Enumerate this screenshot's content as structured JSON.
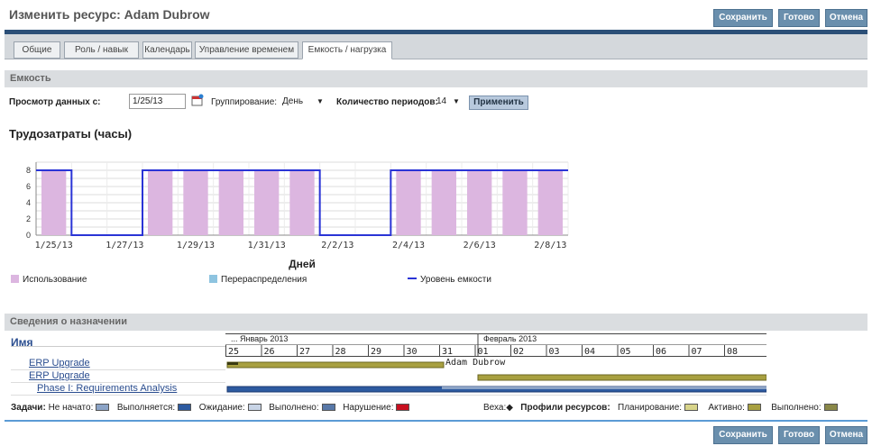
{
  "header": {
    "title": "Изменить ресурс: Adam Dubrow",
    "save": "Сохранить",
    "done": "Готово",
    "cancel": "Отмена"
  },
  "tabs": [
    "Общие",
    "Роль / навык",
    "Календарь",
    "Управление временем",
    "Емкость / нагрузка"
  ],
  "capacity": {
    "section_title": "Емкость",
    "view_from_label": "Просмотр данных с:",
    "view_from_value": "1/25/13",
    "grouping_label": "Группирование:",
    "grouping_value": "День",
    "periods_label": "Количество периодов:",
    "periods_value": "14",
    "apply": "Применить",
    "chart_title": "Трудозатраты (часы)"
  },
  "chart_data": {
    "type": "bar",
    "xlabel": "Дней",
    "ylim": [
      0,
      9
    ],
    "y_ticks": [
      0,
      2,
      4,
      6,
      8
    ],
    "x_tick_labels": [
      "1/25/13",
      "1/27/13",
      "1/29/13",
      "1/31/13",
      "2/2/13",
      "2/4/13",
      "2/6/13",
      "2/8/13"
    ],
    "usage": [
      8,
      0,
      0,
      8,
      8,
      8,
      8,
      8,
      0,
      0,
      8,
      8,
      8,
      8,
      8
    ],
    "capacity": [
      8,
      0,
      0,
      8,
      8,
      8,
      8,
      8,
      0,
      0,
      8,
      8,
      8,
      8,
      8
    ],
    "legend": [
      "Использование",
      "Перераспределения",
      "Уровень емкости"
    ],
    "colors": {
      "usage": "#dcb6e0",
      "realloc": "#8ec4e0",
      "capacity": "#2a34d6"
    }
  },
  "assignments": {
    "section_title": "Сведения о назначении",
    "name_header": "Имя",
    "month1": "... Январь 2013",
    "month2": "Февраль 2013",
    "days": [
      "25",
      "26",
      "27",
      "28",
      "29",
      "30",
      "31",
      "01",
      "02",
      "03",
      "04",
      "05",
      "06",
      "07",
      "08"
    ],
    "rows": [
      "ERP Upgrade",
      "ERP Upgrade",
      "Phase I: Requirements Analysis"
    ],
    "bar_label": "Adam Dubrow"
  },
  "footer_legend": {
    "tasks": "Задачи:",
    "not_started": "Не начато:",
    "in_progress": "Выполняется:",
    "waiting": "Ожидание:",
    "done": "Выполнено:",
    "violation": "Нарушение:",
    "milestone": "Веха:",
    "profiles": "Профили ресурсов:",
    "planning": "Планирование:",
    "active": "Активно:",
    "completed": "Выполнено:"
  }
}
